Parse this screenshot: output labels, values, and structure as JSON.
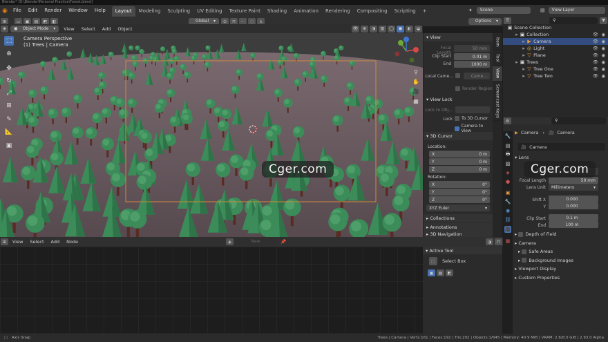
{
  "title_bar": "Blender* [D:\\Blender\\Personal Practice\\Forest.blend]",
  "menu": [
    "File",
    "Edit",
    "Render",
    "Window",
    "Help"
  ],
  "workspaces": [
    "Layout",
    "Modeling",
    "Sculpting",
    "UV Editing",
    "Texture Paint",
    "Shading",
    "Animation",
    "Rendering",
    "Compositing",
    "Scripting",
    "+"
  ],
  "scene": "Scene",
  "view_layer": "View Layer",
  "viewport_header": {
    "mode": "Object Mode",
    "items": [
      "View",
      "Select",
      "Add",
      "Object"
    ],
    "transform": "Global",
    "options": "Options"
  },
  "viewport_overlay": {
    "line1": "Camera Perspective",
    "line2": "(1) Trees | Camera"
  },
  "npanel": {
    "view_title": "View",
    "focal_length_label": "Focal Length",
    "focal_length": "50 mm",
    "clip_start_label": "Clip Start",
    "clip_start": "0.01 m",
    "end_label": "End",
    "end": "1000 m",
    "local_camera_label": "Local Came...",
    "local_camera_value": "Came...",
    "render_region": "Render Region",
    "view_lock": "View Lock",
    "lock_to_obj": "Lock to Obj...",
    "lock_label": "Lock",
    "to_3d_cursor": "To 3D Cursor",
    "camera_to_view": "Camera to View",
    "cursor_title": "3D Cursor",
    "location_label": "Location:",
    "loc": [
      {
        "axis": "X",
        "value": "0 m"
      },
      {
        "axis": "Y",
        "value": "0 m"
      },
      {
        "axis": "Z",
        "value": "0 m"
      }
    ],
    "rotation_label": "Rotation:",
    "rot": [
      {
        "axis": "X",
        "value": "0°"
      },
      {
        "axis": "Y",
        "value": "0°"
      },
      {
        "axis": "Z",
        "value": "0°"
      }
    ],
    "rotation_mode": "XYZ Euler",
    "collections": "Collections",
    "annotations": "Annotations",
    "navigation": "3D Navigation"
  },
  "vtabs": [
    "Item",
    "Tool",
    "View",
    "Screencast Keys"
  ],
  "outliner": {
    "root": "Scene Collection",
    "rows": [
      {
        "name": "Collection",
        "indent": 1,
        "icon": "▣"
      },
      {
        "name": "Camera",
        "indent": 2,
        "icon": "▶",
        "selected": true
      },
      {
        "name": "Light",
        "indent": 2,
        "icon": "◎"
      },
      {
        "name": "Plane",
        "indent": 2,
        "icon": "▽"
      },
      {
        "name": "Trees",
        "indent": 1,
        "icon": "▣"
      },
      {
        "name": "Tree One",
        "indent": 2,
        "icon": "▽"
      },
      {
        "name": "Tree Two",
        "indent": 2,
        "icon": "▽"
      }
    ]
  },
  "properties": {
    "breadcrumb_a": "Camera",
    "breadcrumb_b": "Camera",
    "datablock": "Camera",
    "lens": "Lens",
    "type_label": "Type",
    "focal_length_label": "Focal Length",
    "focal_length": "50 mm",
    "lens_unit_label": "Lens Unit",
    "lens_unit": "Millimeters",
    "shift_x_label": "Shift X",
    "shift_x": "0.000",
    "shift_y_label": "Y",
    "shift_y": "0.000",
    "clip_start_label": "Clip Start",
    "clip_start": "0.1 m",
    "clip_end_label": "End",
    "clip_end": "100 m",
    "panels": [
      "Depth of Field",
      "Camera",
      "Safe Areas",
      "Background Images",
      "Viewport Display",
      "Custom Properties"
    ]
  },
  "node_header": {
    "items": [
      "View",
      "Select",
      "Add",
      "Node"
    ],
    "new": "New"
  },
  "tool_panel": {
    "title": "Active Tool",
    "tool": "Select Box"
  },
  "statusbar": {
    "left": "Axis Snap",
    "right": "Trees | Camera | Verts:161 | Faces:192 | Tris:292 | Objects:1/645 | Memory: 40.9 MiB | VRAM: 2.6/8.0 GiB | 2.93.0 Alpha"
  },
  "watermark": "Cger.com",
  "colors": {
    "accent": "#4772b3",
    "camera_frame": "#d08a3b",
    "tree": "#3c8c5a",
    "trunk": "#5a2b23"
  }
}
